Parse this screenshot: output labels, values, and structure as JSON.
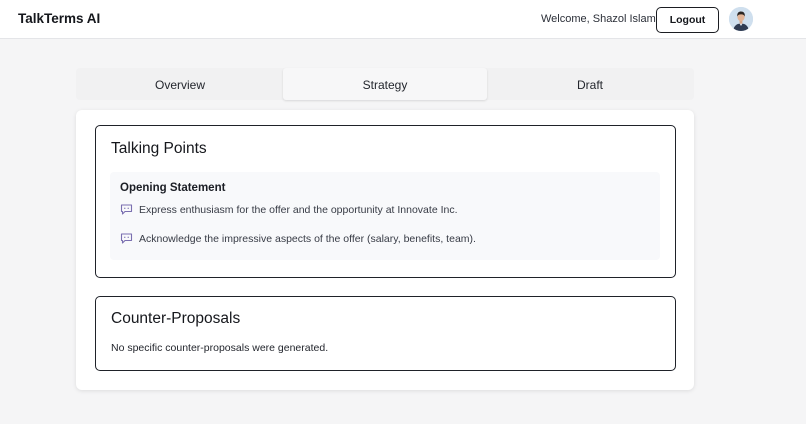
{
  "app": {
    "title": "TalkTerms AI"
  },
  "header": {
    "welcome_text": "Welcome, Shazol Islam",
    "logout_label": "Logout"
  },
  "tabs": [
    {
      "label": "Overview",
      "active": false
    },
    {
      "label": "Strategy",
      "active": true
    },
    {
      "label": "Draft",
      "active": false
    }
  ],
  "talking_points": {
    "title": "Talking Points",
    "section": {
      "heading": "Opening Statement",
      "items": [
        "Express enthusiasm for the offer and the opportunity at Innovate Inc.",
        "Acknowledge the impressive aspects of the offer (salary, benefits, team)."
      ],
      "icon": "chat-bubble-icon"
    }
  },
  "counter_proposals": {
    "title": "Counter-Proposals",
    "text": "No specific counter-proposals were generated."
  },
  "colors": {
    "accent_icon": "#7a6fb0",
    "page_bg": "#f5f5f6",
    "card_border": "#1f2229"
  }
}
